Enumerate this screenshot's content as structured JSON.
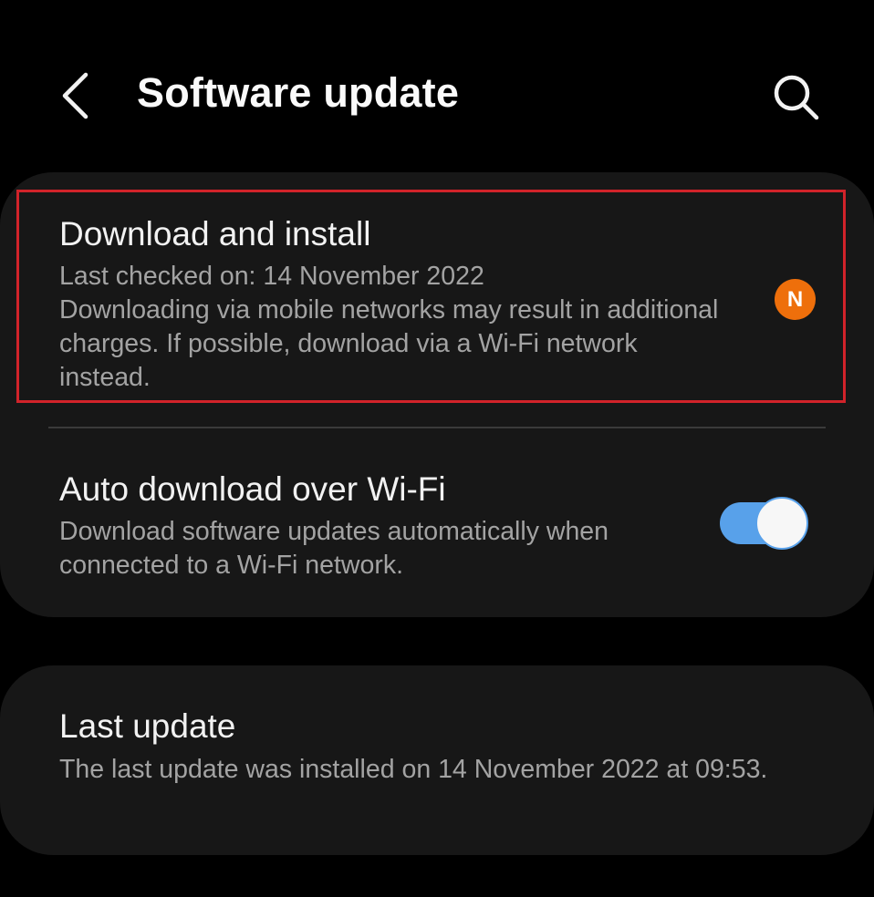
{
  "header": {
    "back_icon": "chevron-left-icon",
    "title": "Software update",
    "search_icon": "search-icon"
  },
  "download_install": {
    "title": "Download and install",
    "last_checked": "Last checked on: 14 November 2022",
    "notice": "Downloading via mobile networks may result in additional charges. If possible, download via a Wi-Fi network instead.",
    "badge": "N",
    "badge_color": "#ee6f0b",
    "highlight_color": "#d1232a"
  },
  "auto_download": {
    "title": "Auto download over Wi-Fi",
    "description": "Download software updates automatically when connected to a Wi-Fi network.",
    "enabled": true,
    "toggle_color": "#58a1ea"
  },
  "last_update": {
    "title": "Last update",
    "description": "The last update was installed on 14 November 2022 at 09:53."
  }
}
